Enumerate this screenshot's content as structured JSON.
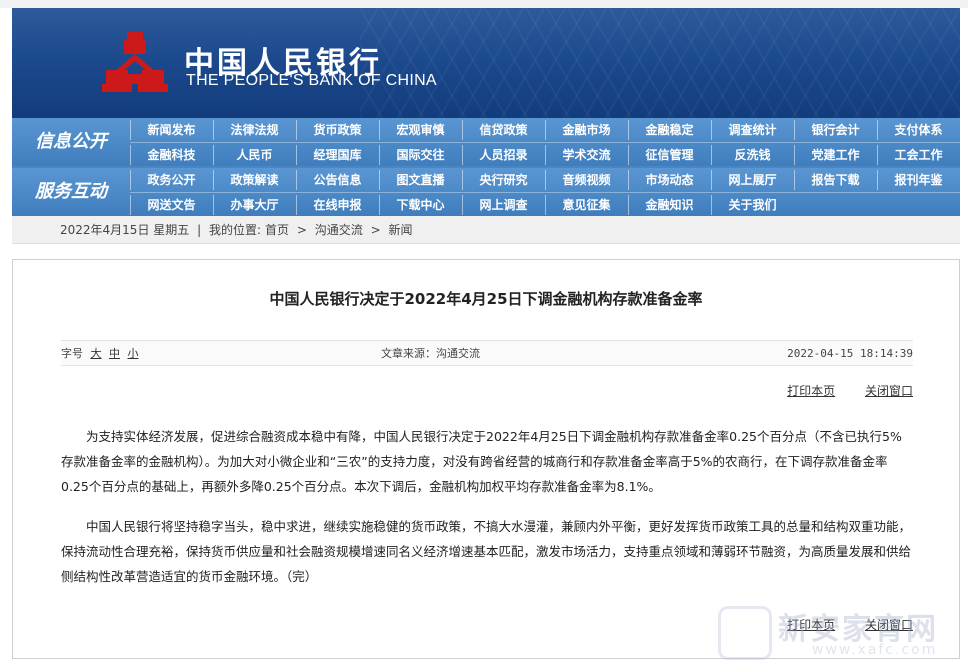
{
  "brand": {
    "name_cn": "中国人民银行",
    "name_en": "THE PEOPLE'S BANK OF CHINA",
    "header_color": "#1c4a8e",
    "emblem_color": "#cc1a1a"
  },
  "nav": {
    "sections": [
      {
        "title": "信息公开",
        "rows": [
          [
            "新闻发布",
            "法律法规",
            "货币政策",
            "宏观审慎",
            "信贷政策",
            "金融市场",
            "金融稳定",
            "调查统计",
            "银行会计",
            "支付体系"
          ],
          [
            "金融科技",
            "人民币",
            "经理国库",
            "国际交往",
            "人员招录",
            "学术交流",
            "征信管理",
            "反洗钱",
            "党建工作",
            "工会工作"
          ]
        ]
      },
      {
        "title": "服务互动",
        "rows": [
          [
            "政务公开",
            "政策解读",
            "公告信息",
            "图文直播",
            "央行研究",
            "音频视频",
            "市场动态",
            "网上展厅",
            "报告下载",
            "报刊年鉴"
          ],
          [
            "网送文告",
            "办事大厅",
            "在线申报",
            "下载中心",
            "网上调查",
            "意见征集",
            "金融知识",
            "关于我们"
          ]
        ]
      }
    ]
  },
  "breadcrumb": {
    "date": "2022年4月15日 星期五",
    "sep": "|",
    "location_label": "我的位置:",
    "items": [
      "首页",
      "沟通交流",
      "新闻"
    ],
    "arrow": ">"
  },
  "article": {
    "title": "中国人民银行决定于2022年4月25日下调金融机构存款准备金率",
    "font_size_label": "字号",
    "font_sizes": [
      "大",
      "中",
      "小"
    ],
    "source": "文章来源：沟通交流",
    "timestamp": "2022-04-15 18:14:39",
    "print_label": "打印本页",
    "close_label": "关闭窗口",
    "paragraphs": [
      "为支持实体经济发展，促进综合融资成本稳中有降，中国人民银行决定于2022年4月25日下调金融机构存款准备金率0.25个百分点（不含已执行5%存款准备金率的金融机构）。为加大对小微企业和“三农”的支持力度，对没有跨省经营的城商行和存款准备金率高于5%的农商行，在下调存款准备金率0.25个百分点的基础上，再额外多降0.25个百分点。本次下调后，金融机构加权平均存款准备金率为8.1%。",
      "中国人民银行将坚持稳字当头，稳中求进，继续实施稳健的货币政策，不搞大水漫灌，兼顾内外平衡，更好发挥货币政策工具的总量和结构双重功能，保持流动性合理充裕，保持货币供应量和社会融资规模增速同名义经济增速基本匹配，激发市场活力，支持重点领域和薄弱环节融资，为高质量发展和供给侧结构性改革营造适宜的货币金融环境。（完）"
    ]
  },
  "watermark": {
    "text_cn": "新安家育网",
    "url": "www.xafc.com"
  }
}
